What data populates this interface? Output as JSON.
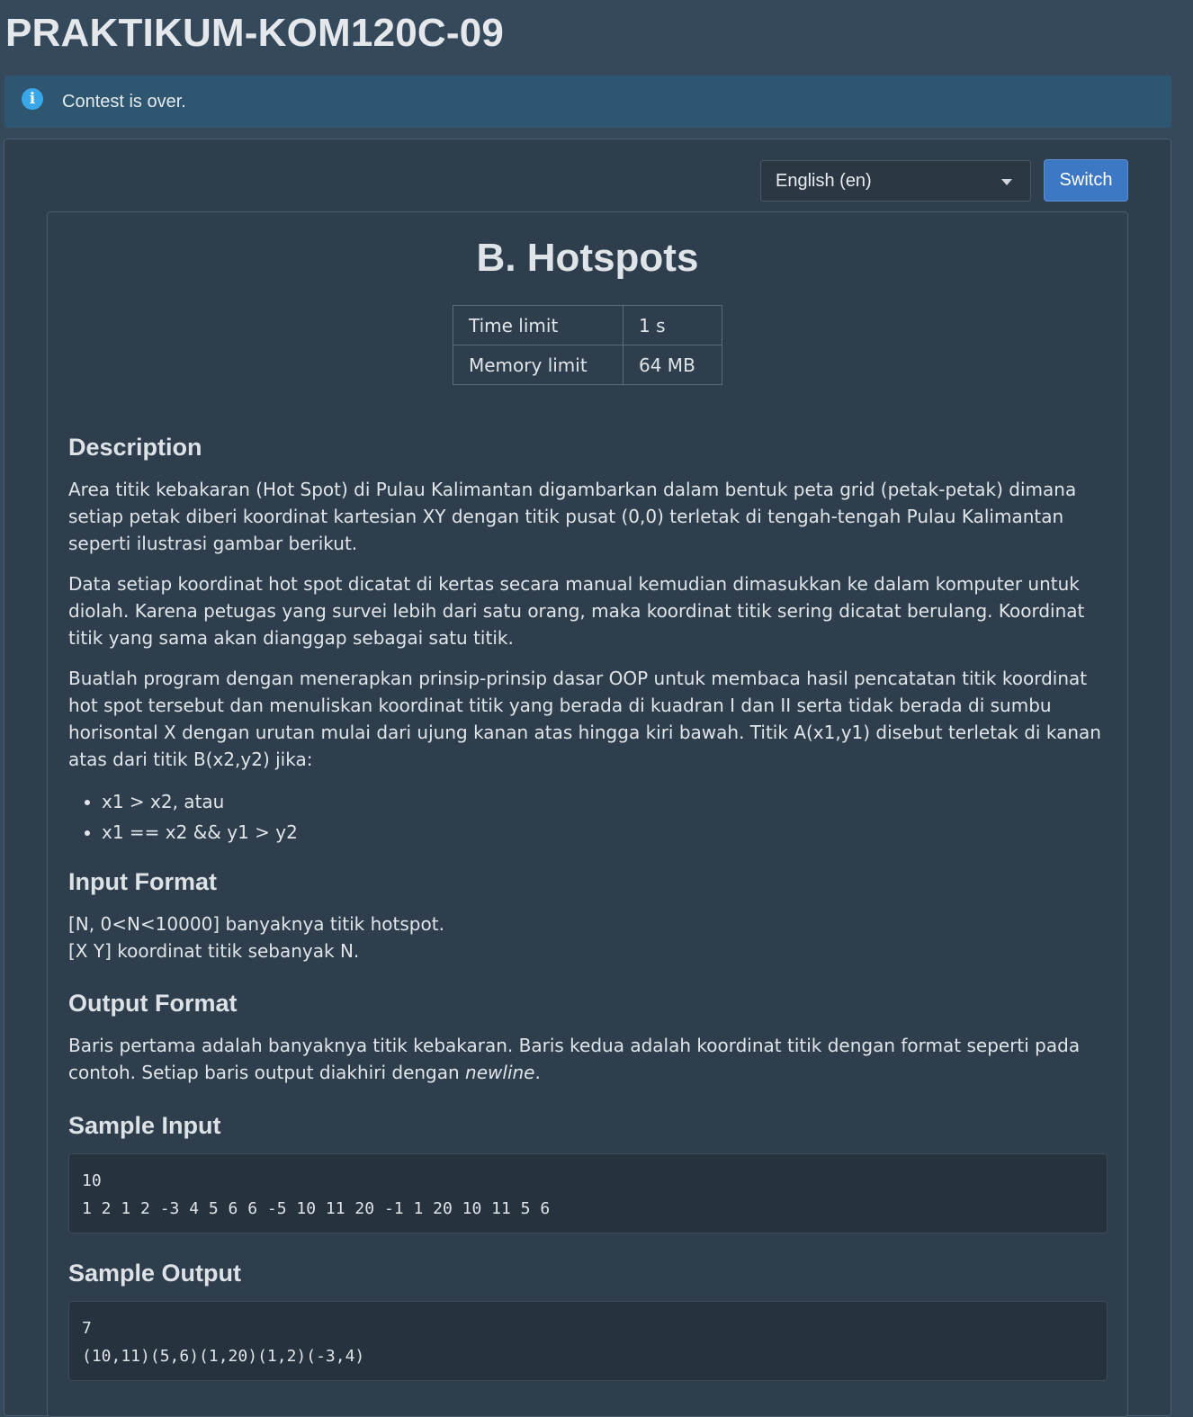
{
  "contest": {
    "title": "PRAKTIKUM-KOM120C-09"
  },
  "alert": {
    "icon": "info-icon",
    "message": "Contest is over."
  },
  "language": {
    "selected": "English (en)",
    "switch_label": "Switch"
  },
  "problem": {
    "title": "B. Hotspots",
    "limits": [
      {
        "label": "Time limit",
        "value": "1 s"
      },
      {
        "label": "Memory limit",
        "value": "64 MB"
      }
    ],
    "description": {
      "heading": "Description",
      "paragraphs": [
        "Area titik kebakaran (Hot Spot) di Pulau Kalimantan digambarkan dalam bentuk peta grid (petak-petak) dimana setiap petak diberi koordinat kartesian XY dengan titik pusat (0,0) terletak di tengah-tengah Pulau Kalimantan seperti ilustrasi gambar berikut.",
        "Data setiap koordinat hot spot dicatat di kertas secara manual kemudian dimasukkan ke dalam komputer untuk diolah. Karena petugas yang survei lebih dari satu orang, maka koordinat titik sering dicatat berulang. Koordinat titik yang sama akan dianggap sebagai satu titik.",
        "Buatlah program dengan menerapkan prinsip-prinsip dasar OOP untuk membaca hasil pencatatan titik koordinat hot spot tersebut dan menuliskan koordinat titik yang berada di kuadran I dan II serta tidak berada di sumbu horisontal X dengan urutan mulai dari ujung kanan atas hingga kiri bawah. Titik A(x1,y1) disebut terletak di kanan atas dari titik B(x2,y2) jika:"
      ],
      "conditions": [
        "x1 > x2, atau",
        "x1 == x2 && y1 > y2"
      ]
    },
    "input_format": {
      "heading": "Input Format",
      "lines": [
        "[N, 0<N<10000] banyaknya titik hotspot.",
        "[X Y] koordinat titik sebanyak N."
      ]
    },
    "output_format": {
      "heading": "Output Format",
      "text_before": "Baris pertama adalah banyaknya titik kebakaran. Baris kedua adalah koordinat titik dengan format seperti pada contoh. Setiap baris output diakhiri dengan ",
      "emphasis": "newline",
      "text_after": "."
    },
    "sample_input": {
      "heading": "Sample Input",
      "content": "10\n1 2 1 2 -3 4 5 6 6 -5 10 11 20 -1 1 20 10 11 5 6"
    },
    "sample_output": {
      "heading": "Sample Output",
      "content": "7\n(10,11)(5,6)(1,20)(1,2)(-3,4)"
    }
  }
}
